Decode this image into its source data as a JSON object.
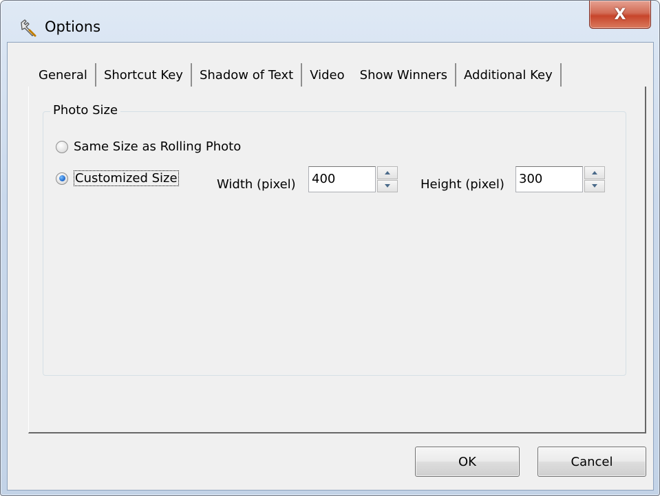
{
  "window": {
    "title": "Options",
    "close_label": "X"
  },
  "tabs": [
    {
      "label": "General"
    },
    {
      "label": "Shortcut Key"
    },
    {
      "label": "Shadow of Text"
    },
    {
      "label": "Video"
    },
    {
      "label": "Show Winners",
      "selected": true
    },
    {
      "label": "Additional Key"
    }
  ],
  "photo_size": {
    "group_label": "Photo Size",
    "option_same": "Same Size as Rolling Photo",
    "option_custom": "Customized Size",
    "selected_option": "Customized Size",
    "width_label": "Width (pixel)",
    "width_value": "400",
    "height_label": "Height (pixel)",
    "height_value": "300"
  },
  "buttons": {
    "ok": "OK",
    "cancel": "Cancel"
  },
  "icons": {
    "title_icon": "wrench-icon",
    "close_icon": "close-icon"
  },
  "colors": {
    "selected_radio": "#1b64c8",
    "close_button": "#c7452b",
    "dialog_bg": "#f0f0f0"
  }
}
